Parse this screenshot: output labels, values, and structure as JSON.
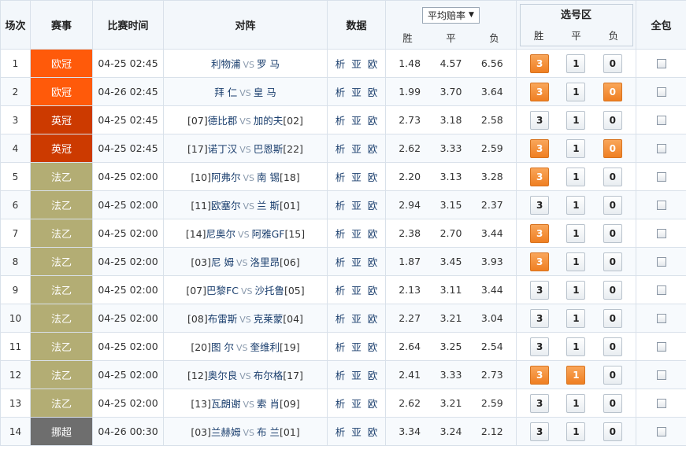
{
  "headers": {
    "num": "场次",
    "league": "赛事",
    "time": "比赛时间",
    "match": "对阵",
    "data": "数据",
    "avg_odds_select": "平均赔率",
    "win": "胜",
    "draw": "平",
    "lose": "负",
    "pick_area": "选号区",
    "full": "全包"
  },
  "colors": {
    "euro": "#ff5a0a",
    "cup": "#cc3a00",
    "fr2": "#b3ad74",
    "nor": "#6e6e6e",
    "pick_on": "#ef7f22"
  },
  "links": [
    "析",
    "亚",
    "欧"
  ],
  "vs": "VS",
  "rows": [
    {
      "num": "1",
      "league": "欧冠",
      "league_color": "#ff5a0a",
      "time": "04-25 02:45",
      "home_rank": "",
      "home": "利物浦",
      "away": "罗 马",
      "away_rank": "",
      "odds": [
        "1.48",
        "4.57",
        "6.56"
      ],
      "picks": [
        {
          "label": "3",
          "on": true
        },
        {
          "label": "1",
          "on": false
        },
        {
          "label": "0",
          "on": false
        }
      ]
    },
    {
      "num": "2",
      "league": "欧冠",
      "league_color": "#ff5a0a",
      "time": "04-26 02:45",
      "home_rank": "",
      "home": "拜 仁",
      "away": "皇 马",
      "away_rank": "",
      "odds": [
        "1.99",
        "3.70",
        "3.64"
      ],
      "picks": [
        {
          "label": "3",
          "on": true
        },
        {
          "label": "1",
          "on": false
        },
        {
          "label": "0",
          "on": true
        }
      ]
    },
    {
      "num": "3",
      "league": "英冠",
      "league_color": "#cc3a00",
      "time": "04-25 02:45",
      "home_rank": "[07]",
      "home": "德比郡",
      "away": "加的夫",
      "away_rank": "[02]",
      "odds": [
        "2.73",
        "3.18",
        "2.58"
      ],
      "picks": [
        {
          "label": "3",
          "on": false
        },
        {
          "label": "1",
          "on": false
        },
        {
          "label": "0",
          "on": false
        }
      ]
    },
    {
      "num": "4",
      "league": "英冠",
      "league_color": "#cc3a00",
      "time": "04-25 02:45",
      "home_rank": "[17]",
      "home": "诺丁汉",
      "away": "巴恩斯",
      "away_rank": "[22]",
      "odds": [
        "2.62",
        "3.33",
        "2.59"
      ],
      "picks": [
        {
          "label": "3",
          "on": true
        },
        {
          "label": "1",
          "on": false
        },
        {
          "label": "0",
          "on": true
        }
      ]
    },
    {
      "num": "5",
      "league": "法乙",
      "league_color": "#b3ad74",
      "time": "04-25 02:00",
      "home_rank": "[10]",
      "home": "阿弗尔",
      "away": "南 锡",
      "away_rank": "[18]",
      "odds": [
        "2.20",
        "3.13",
        "3.28"
      ],
      "picks": [
        {
          "label": "3",
          "on": true
        },
        {
          "label": "1",
          "on": false
        },
        {
          "label": "0",
          "on": false
        }
      ]
    },
    {
      "num": "6",
      "league": "法乙",
      "league_color": "#b3ad74",
      "time": "04-25 02:00",
      "home_rank": "[11]",
      "home": "欧塞尔",
      "away": "兰 斯",
      "away_rank": "[01]",
      "odds": [
        "2.94",
        "3.15",
        "2.37"
      ],
      "picks": [
        {
          "label": "3",
          "on": false
        },
        {
          "label": "1",
          "on": false
        },
        {
          "label": "0",
          "on": false
        }
      ]
    },
    {
      "num": "7",
      "league": "法乙",
      "league_color": "#b3ad74",
      "time": "04-25 02:00",
      "home_rank": "[14]",
      "home": "尼奥尔",
      "away": "阿雅GF",
      "away_rank": "[15]",
      "odds": [
        "2.38",
        "2.70",
        "3.44"
      ],
      "picks": [
        {
          "label": "3",
          "on": true
        },
        {
          "label": "1",
          "on": false
        },
        {
          "label": "0",
          "on": false
        }
      ]
    },
    {
      "num": "8",
      "league": "法乙",
      "league_color": "#b3ad74",
      "time": "04-25 02:00",
      "home_rank": "[03]",
      "home": "尼 姆",
      "away": "洛里昂",
      "away_rank": "[06]",
      "odds": [
        "1.87",
        "3.45",
        "3.93"
      ],
      "picks": [
        {
          "label": "3",
          "on": true
        },
        {
          "label": "1",
          "on": false
        },
        {
          "label": "0",
          "on": false
        }
      ]
    },
    {
      "num": "9",
      "league": "法乙",
      "league_color": "#b3ad74",
      "time": "04-25 02:00",
      "home_rank": "[07]",
      "home": "巴黎FC",
      "away": "沙托鲁",
      "away_rank": "[05]",
      "odds": [
        "2.13",
        "3.11",
        "3.44"
      ],
      "picks": [
        {
          "label": "3",
          "on": false
        },
        {
          "label": "1",
          "on": false
        },
        {
          "label": "0",
          "on": false
        }
      ]
    },
    {
      "num": "10",
      "league": "法乙",
      "league_color": "#b3ad74",
      "time": "04-25 02:00",
      "home_rank": "[08]",
      "home": "布雷斯",
      "away": "克莱蒙",
      "away_rank": "[04]",
      "odds": [
        "2.27",
        "3.21",
        "3.04"
      ],
      "picks": [
        {
          "label": "3",
          "on": false
        },
        {
          "label": "1",
          "on": false
        },
        {
          "label": "0",
          "on": false
        }
      ]
    },
    {
      "num": "11",
      "league": "法乙",
      "league_color": "#b3ad74",
      "time": "04-25 02:00",
      "home_rank": "[20]",
      "home": "图 尔",
      "away": "奎维利",
      "away_rank": "[19]",
      "odds": [
        "2.64",
        "3.25",
        "2.54"
      ],
      "picks": [
        {
          "label": "3",
          "on": false
        },
        {
          "label": "1",
          "on": false
        },
        {
          "label": "0",
          "on": false
        }
      ]
    },
    {
      "num": "12",
      "league": "法乙",
      "league_color": "#b3ad74",
      "time": "04-25 02:00",
      "home_rank": "[12]",
      "home": "奥尔良",
      "away": "布尔格",
      "away_rank": "[17]",
      "odds": [
        "2.41",
        "3.33",
        "2.73"
      ],
      "picks": [
        {
          "label": "3",
          "on": true
        },
        {
          "label": "1",
          "on": true
        },
        {
          "label": "0",
          "on": false
        }
      ]
    },
    {
      "num": "13",
      "league": "法乙",
      "league_color": "#b3ad74",
      "time": "04-25 02:00",
      "home_rank": "[13]",
      "home": "瓦朗谢",
      "away": "索 肖",
      "away_rank": "[09]",
      "odds": [
        "2.62",
        "3.21",
        "2.59"
      ],
      "picks": [
        {
          "label": "3",
          "on": false
        },
        {
          "label": "1",
          "on": false
        },
        {
          "label": "0",
          "on": false
        }
      ]
    },
    {
      "num": "14",
      "league": "挪超",
      "league_color": "#6e6e6e",
      "time": "04-26 00:30",
      "home_rank": "[03]",
      "home": "兰赫姆",
      "away": "布 兰",
      "away_rank": "[01]",
      "odds": [
        "3.34",
        "3.24",
        "2.12"
      ],
      "picks": [
        {
          "label": "3",
          "on": false
        },
        {
          "label": "1",
          "on": false
        },
        {
          "label": "0",
          "on": false
        }
      ]
    }
  ]
}
